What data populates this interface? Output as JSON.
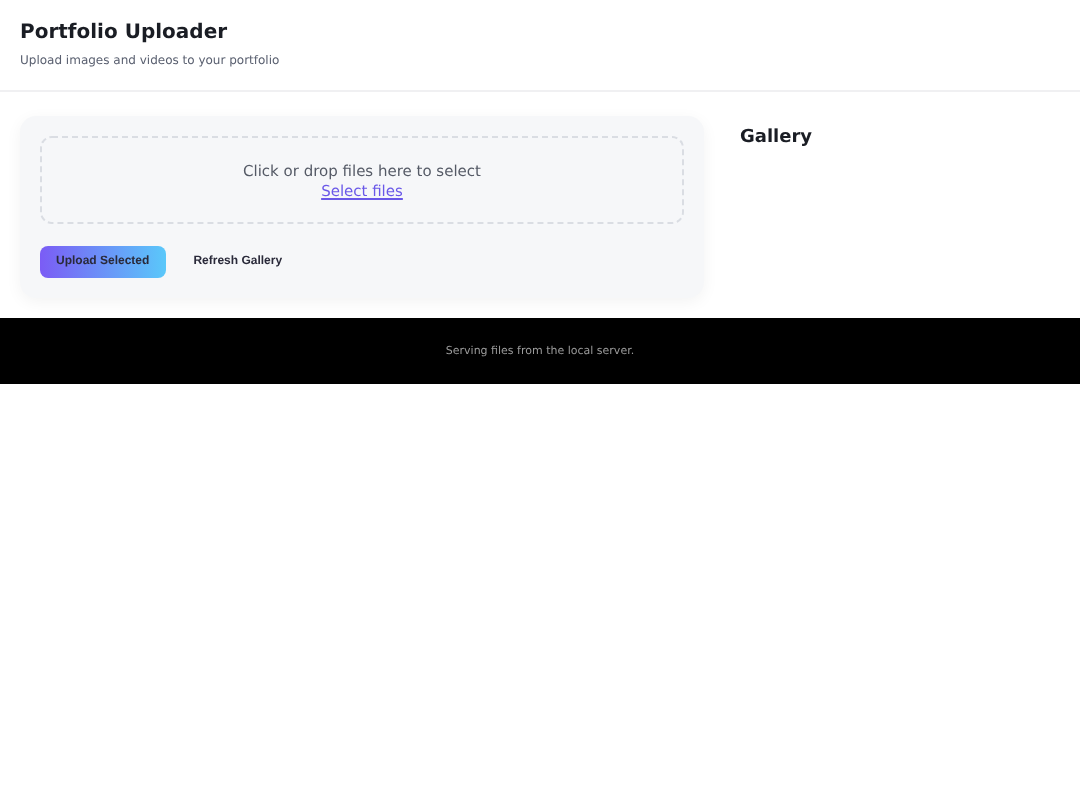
{
  "header": {
    "title": "Portfolio Uploader",
    "subtitle": "Upload images and videos to your portfolio"
  },
  "dropzone": {
    "prompt": "Click or drop files here to select",
    "link": "Select files"
  },
  "buttons": [
    {
      "label": "Upload Selected",
      "kind": "primary"
    },
    {
      "label": "Refresh Gallery",
      "kind": "plain"
    }
  ],
  "gallery": {
    "title": "Gallery"
  },
  "footer": {
    "text": "Serving files from the local server."
  }
}
